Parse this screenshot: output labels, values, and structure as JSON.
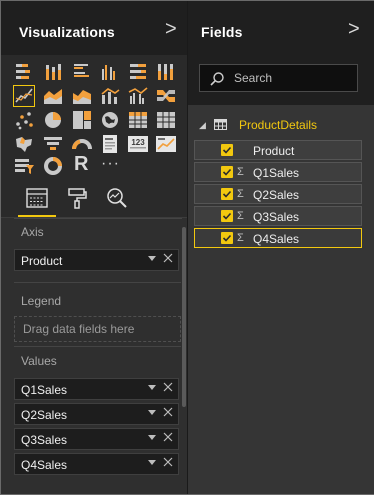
{
  "visualizations": {
    "title": "Visualizations",
    "chevron": ">",
    "icons": [
      "stacked-bar-icon",
      "stacked-column-icon",
      "clustered-bar-icon",
      "clustered-column-icon",
      "100-bar-icon",
      "100-column-icon",
      "line-chart-icon",
      "area-chart-icon",
      "stacked-area-icon",
      "line-column-icon",
      "line-clustered-column-icon",
      "ribbon-chart-icon",
      "scatter-chart-icon",
      "pie-chart-icon",
      "treemap-icon",
      "map-icon",
      "matrix-icon",
      "table-icon",
      "filled-map-icon",
      "funnel-icon",
      "gauge-icon",
      "card-icon",
      "multi-row-card-icon",
      "kpi-icon",
      "slicer-icon",
      "donut-chart-icon",
      "r-visual-icon",
      "more-icon"
    ],
    "tabs": [
      "fields-tab-icon",
      "format-tab-icon",
      "analytics-tab-icon"
    ],
    "axis": {
      "label": "Axis",
      "wells": [
        {
          "name": "Product"
        }
      ]
    },
    "legend": {
      "label": "Legend",
      "placeholder": "Drag data fields here"
    },
    "values": {
      "label": "Values",
      "wells": [
        {
          "name": "Q1Sales"
        },
        {
          "name": "Q2Sales"
        },
        {
          "name": "Q3Sales"
        },
        {
          "name": "Q4Sales"
        }
      ]
    },
    "r_label": "R",
    "more_label": "···"
  },
  "fields": {
    "title": "Fields",
    "chevron": ">",
    "search_placeholder": "Search",
    "table": {
      "name": "ProductDetails",
      "expander": "◢"
    },
    "sigma": "Σ",
    "items": [
      {
        "name": "Product",
        "checked": true,
        "measure": false,
        "selected": false
      },
      {
        "name": "Q1Sales",
        "checked": true,
        "measure": true,
        "selected": false
      },
      {
        "name": "Q2Sales",
        "checked": true,
        "measure": true,
        "selected": false
      },
      {
        "name": "Q3Sales",
        "checked": true,
        "measure": true,
        "selected": false
      },
      {
        "name": "Q4Sales",
        "checked": true,
        "measure": true,
        "selected": true
      }
    ]
  },
  "colors": {
    "accent": "#f2c80f",
    "header_bg": "#1f1f1f",
    "pane_bg": "#2f2f2f"
  }
}
